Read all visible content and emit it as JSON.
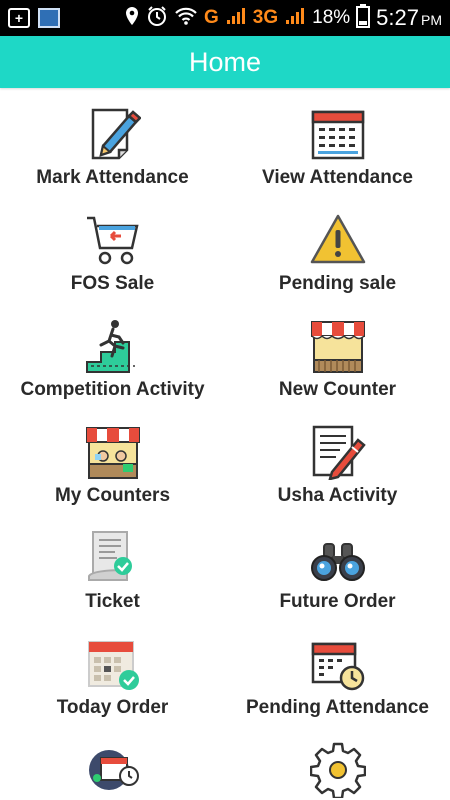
{
  "status_bar": {
    "battery": "18%",
    "time": "5:27",
    "ampm": "PM",
    "network": "G",
    "network2": "3G"
  },
  "header": {
    "title": "Home"
  },
  "accent_color": "#1ed8c6",
  "tiles": [
    {
      "label": "Mark Attendance",
      "icon": "pencil-paper-icon"
    },
    {
      "label": "View Attendance",
      "icon": "calendar-icon"
    },
    {
      "label": "FOS Sale",
      "icon": "shopping-cart-icon"
    },
    {
      "label": "Pending sale",
      "icon": "warning-icon"
    },
    {
      "label": "Competition Activity",
      "icon": "stairs-runner-icon"
    },
    {
      "label": "New Counter",
      "icon": "shop-awning-icon"
    },
    {
      "label": "My Counters",
      "icon": "shop-counter-icon"
    },
    {
      "label": "Usha Activity",
      "icon": "document-pen-icon"
    },
    {
      "label": "Ticket",
      "icon": "receipt-check-icon"
    },
    {
      "label": "Future Order",
      "icon": "binoculars-icon"
    },
    {
      "label": "Today Order",
      "icon": "calendar-check-icon"
    },
    {
      "label": "Pending Attendance",
      "icon": "calendar-clock-icon"
    },
    {
      "label": "",
      "icon": "schedule-globe-icon"
    },
    {
      "label": "",
      "icon": "settings-gear-icon"
    }
  ]
}
